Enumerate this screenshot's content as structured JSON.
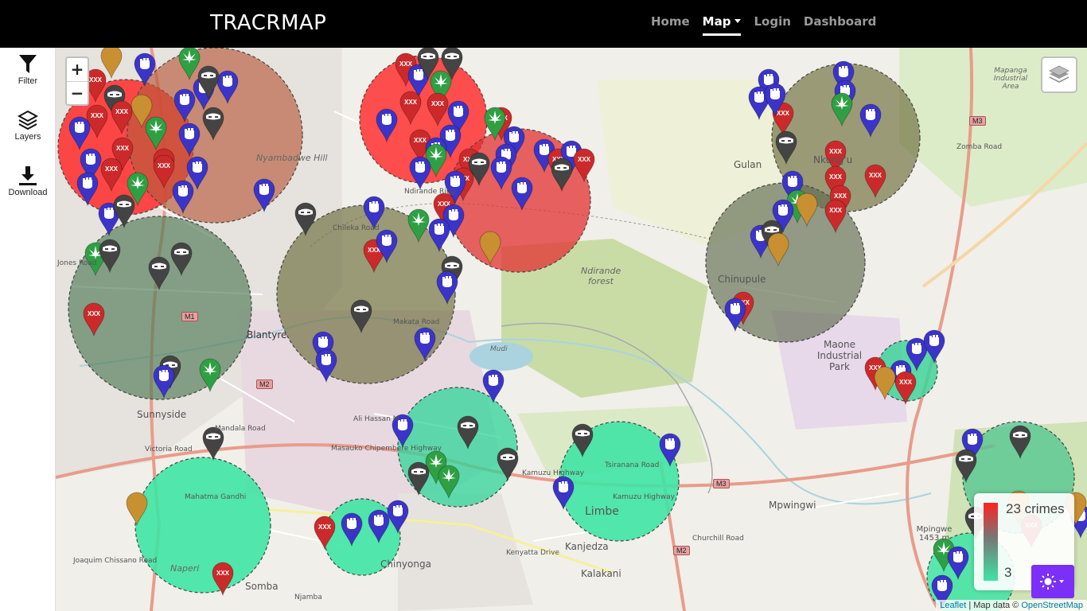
{
  "navbar": {
    "brand": "TRACRMAP",
    "links": [
      {
        "label": "Home",
        "active": false
      },
      {
        "label": "Map",
        "active": true,
        "dropdown": true
      },
      {
        "label": "Login",
        "active": false
      },
      {
        "label": "Dashboard",
        "active": false
      }
    ]
  },
  "sidebar": {
    "items": [
      {
        "label": "Filter",
        "icon": "filter-icon"
      },
      {
        "label": "Layers",
        "icon": "layers-icon"
      },
      {
        "label": "Download",
        "icon": "download-icon"
      }
    ]
  },
  "map": {
    "zoom_in": "+",
    "zoom_out": "−",
    "legend": {
      "max_label": "23 crimes",
      "min_label": "3",
      "max_color": "#ff2a2a",
      "mid_color": "#7a7a7a",
      "min_color": "#3fe4a4"
    },
    "attribution": {
      "leaflet": "Leaflet",
      "separator": " | Map data © ",
      "osm": "OpenStreetMap"
    },
    "places": [
      {
        "name": "Nyambadwe Hill",
        "italic": true
      },
      {
        "name": "Ndirande forest",
        "italic": true
      },
      {
        "name": "Blantyre",
        "italic": false
      },
      {
        "name": "Sunnyside",
        "italic": false
      },
      {
        "name": "Naperi",
        "italic": true
      },
      {
        "name": "Somba",
        "italic": false
      },
      {
        "name": "Chinyonga",
        "italic": false
      },
      {
        "name": "Kanjedza",
        "italic": false
      },
      {
        "name": "Kalakani",
        "italic": false
      },
      {
        "name": "Limbe",
        "italic": false
      },
      {
        "name": "Mpwingwi",
        "italic": false
      },
      {
        "name": "Maone Industrial Park",
        "italic": false
      },
      {
        "name": "Chinupule",
        "italic": false
      },
      {
        "name": "Gulan",
        "italic": false
      },
      {
        "name": "Nkung'u",
        "italic": false
      },
      {
        "name": "Mapanga Industrial Area",
        "italic": true
      },
      {
        "name": "Mpingwe 1453 m",
        "italic": false
      },
      {
        "name": "Mudi",
        "italic": true
      },
      {
        "name": "Ali Hassan M",
        "italic": false
      },
      {
        "name": "Masauko Chipembere Highway",
        "italic": false
      },
      {
        "name": "Kamuzu Highway",
        "italic": false
      },
      {
        "name": "Churchill Road",
        "italic": false
      },
      {
        "name": "Kenyatta Drive",
        "italic": false
      },
      {
        "name": "Mahatma Gandhi",
        "italic": false
      },
      {
        "name": "Joaquim Chissano Road",
        "italic": false
      },
      {
        "name": "Victoria Road",
        "italic": false
      },
      {
        "name": "Mandala Road",
        "italic": false
      },
      {
        "name": "Zomba Road",
        "italic": false
      },
      {
        "name": "Jones Road",
        "italic": false
      },
      {
        "name": "Makata Road",
        "italic": false
      },
      {
        "name": "Chileka Road",
        "italic": false
      },
      {
        "name": "Ndirande Ring",
        "italic": false
      },
      {
        "name": "Kamuzu Highway",
        "italic": false
      },
      {
        "name": "Tsiranana Road",
        "italic": false
      },
      {
        "name": "Njamba",
        "italic": false
      }
    ],
    "road_refs": [
      "M1",
      "M2",
      "M3",
      "M3",
      "M2",
      "M3"
    ]
  },
  "clusters": [
    {
      "color": "#ff2a2a",
      "count_hint": "high"
    },
    {
      "color": "#b85a3c",
      "count_hint": "medium-high"
    },
    {
      "color": "#ff2a2a",
      "count_hint": "high"
    },
    {
      "color": "#e23030",
      "count_hint": "high"
    },
    {
      "color": "#6b6b3a",
      "count_hint": "medium"
    },
    {
      "color": "#4f7a55",
      "count_hint": "medium-low"
    },
    {
      "color": "#6b6b3a",
      "count_hint": "medium"
    },
    {
      "color": "#5f6a50",
      "count_hint": "medium"
    },
    {
      "color": "#2fd49a",
      "count_hint": "low"
    },
    {
      "color": "#3fe4a4",
      "count_hint": "low"
    },
    {
      "color": "#3fe4a4",
      "count_hint": "low"
    },
    {
      "color": "#3fe4a4",
      "count_hint": "low"
    },
    {
      "color": "#3fd49a",
      "count_hint": "low"
    },
    {
      "color": "#4fc690",
      "count_hint": "low"
    },
    {
      "color": "#3fe4a4",
      "count_hint": "low"
    }
  ],
  "marker_types": {
    "assault": {
      "color": "#3b34c9",
      "icon": "fist-icon"
    },
    "theft": {
      "color": "#444444",
      "icon": "bandit-mask-icon"
    },
    "drugs": {
      "color": "#2ea043",
      "icon": "cannabis-leaf-icon"
    },
    "sexual": {
      "color": "#cc2a2a",
      "icon": "xxx-icon",
      "text": "XXX"
    },
    "other": {
      "color": "#c89030",
      "icon": "blank-pin-icon"
    }
  }
}
